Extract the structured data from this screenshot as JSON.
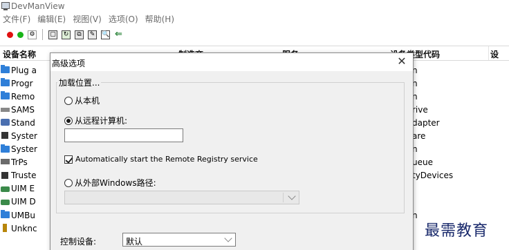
{
  "window": {
    "title": "DevManView"
  },
  "menu": [
    "文件(F)",
    "编辑(E)",
    "视图(V)",
    "选项(O)",
    "帮助(H)"
  ],
  "toolbar": {
    "colors": {
      "red": "#e01010",
      "green": "#18b418"
    }
  },
  "columns": {
    "name": "设备名称",
    "manufacturer": "制造商",
    "service": "服务",
    "type_code": "设备类型代码",
    "extra": "设"
  },
  "devices": [
    {
      "name": "Plug a",
      "right": "n",
      "icon": "folder-icon"
    },
    {
      "name": "Progr",
      "right": "n",
      "icon": "folder-icon"
    },
    {
      "name": "Remo",
      "right": "n",
      "icon": "folder-icon"
    },
    {
      "name": "SAMS",
      "right": "rive",
      "icon": "drive-icon"
    },
    {
      "name": "Stand",
      "right": "dapter",
      "icon": "network-icon"
    },
    {
      "name": "Syster",
      "right": "are",
      "icon": "chip-icon"
    },
    {
      "name": "Syster",
      "right": "n",
      "icon": "folder-icon"
    },
    {
      "name": "TrPs",
      "right": "ueue",
      "icon": "printer-icon"
    },
    {
      "name": "Truste",
      "right": "tyDevices",
      "icon": "chip-icon"
    },
    {
      "name": "UIM E",
      "right": "",
      "icon": "card-icon"
    },
    {
      "name": "UIM D",
      "right": "",
      "icon": "card-icon"
    },
    {
      "name": "UMBu",
      "right": "n",
      "icon": "folder-icon"
    },
    {
      "name": "Unknc",
      "right": "",
      "icon": "plug-icon"
    }
  ],
  "dialog": {
    "title": "高级选项",
    "close": "✕",
    "group_label": "加载位置...",
    "local": "从本机",
    "remote": "从远程计算机:",
    "remote_value": "",
    "auto_start": "Automatically start the Remote Registry service",
    "external": "从外部Windows路径:",
    "external_value": "",
    "control_label": "控制设备:",
    "control_value": "默认",
    "selected_option": "remote",
    "auto_start_checked": true
  },
  "watermark": "最需教育"
}
